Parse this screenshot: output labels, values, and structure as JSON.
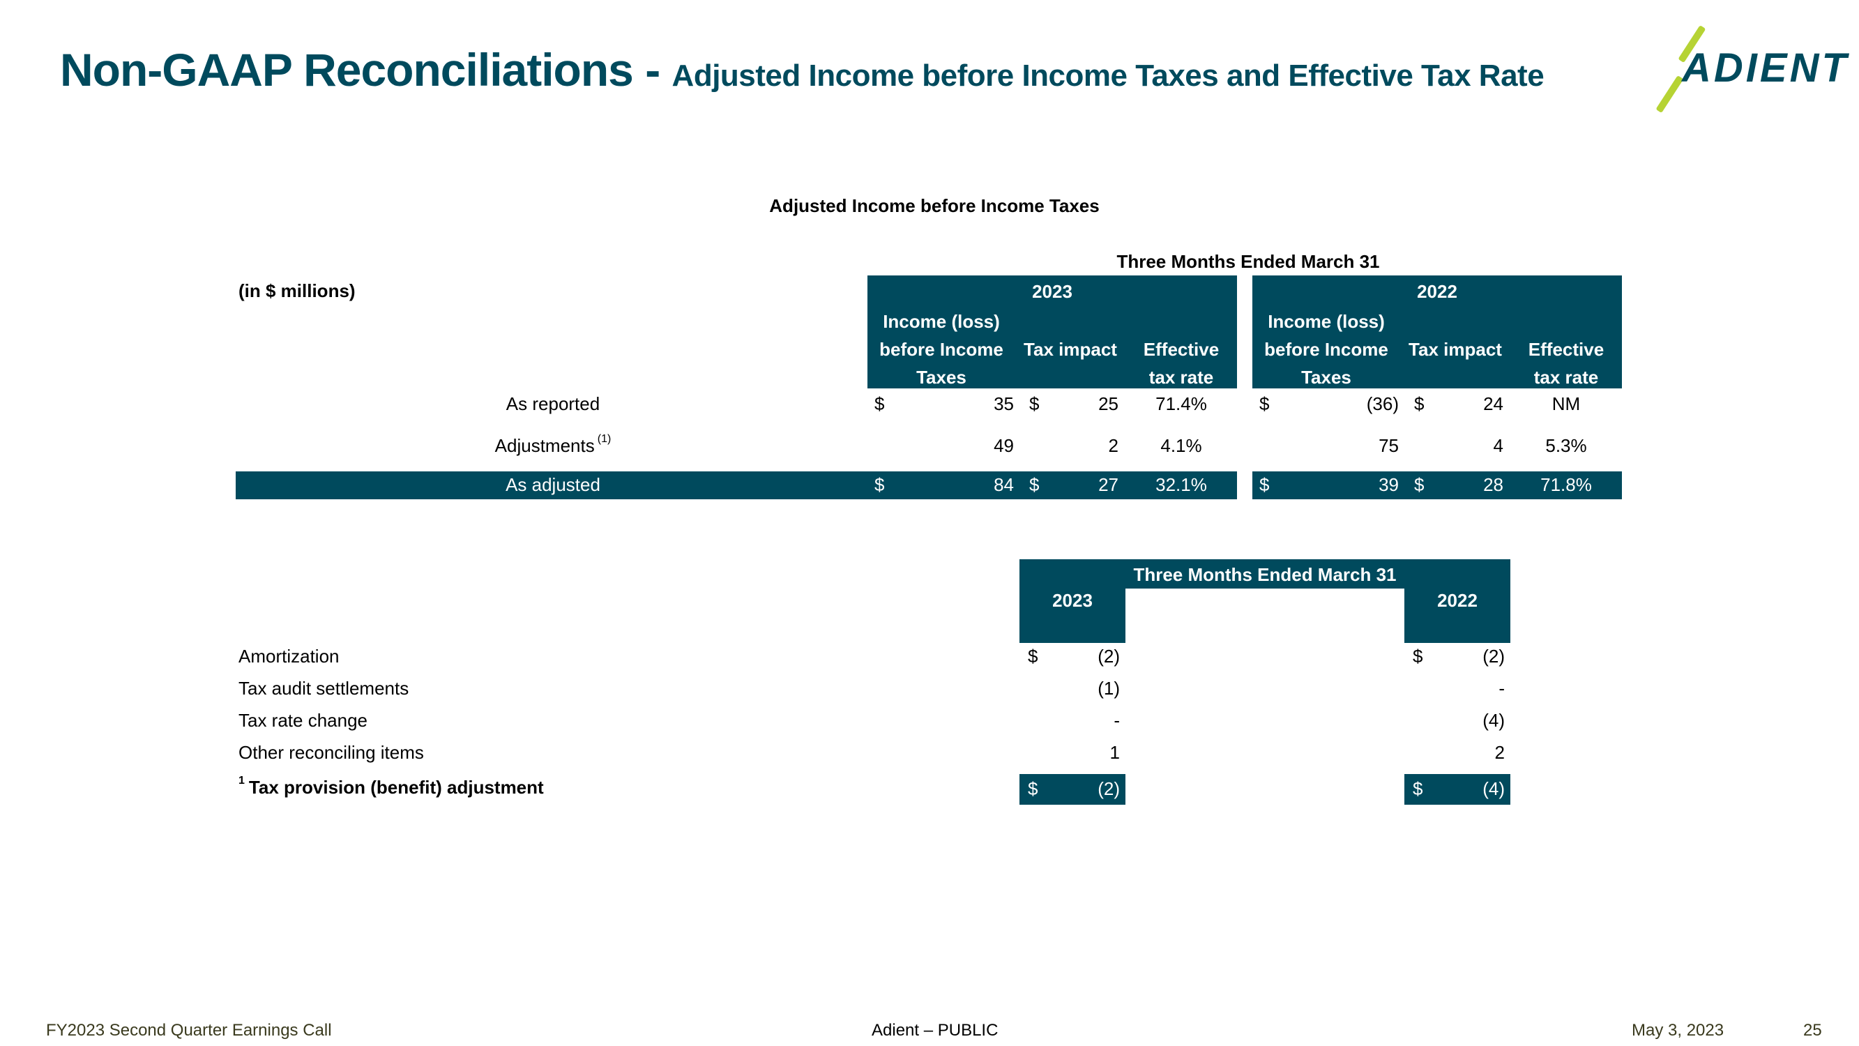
{
  "header": {
    "title_main": "Non-GAAP Reconciliations - ",
    "title_sub": "Adjusted Income before Income Taxes and Effective Tax Rate",
    "logo_text": "ADIENT",
    "colors": {
      "brand_teal": "#004a5d",
      "brand_lime": "#b6d334"
    }
  },
  "table1": {
    "title": "Adjusted Income before Income Taxes",
    "period_label": "Three Months Ended March 31",
    "units_label": "(in $ millions)",
    "years": [
      "2023",
      "2022"
    ],
    "columns": {
      "income": [
        "Income (loss)",
        "before Income",
        "Taxes"
      ],
      "tax_impact": "Tax impact",
      "etr": [
        "Effective",
        "tax rate"
      ]
    },
    "rows": [
      {
        "label": "As reported",
        "footnote": "",
        "y2023": {
          "income_cur": "$",
          "income": "35",
          "tax_cur": "$",
          "tax": "25",
          "etr": "71.4%"
        },
        "y2022": {
          "income_cur": "$",
          "income": "(36)",
          "tax_cur": "$",
          "tax": "24",
          "etr": "NM"
        }
      },
      {
        "label": "Adjustments",
        "footnote": "(1)",
        "y2023": {
          "income_cur": "",
          "income": "49",
          "tax_cur": "",
          "tax": "2",
          "etr": "4.1%"
        },
        "y2022": {
          "income_cur": "",
          "income": "75",
          "tax_cur": "",
          "tax": "4",
          "etr": "5.3%"
        }
      },
      {
        "label": "As adjusted",
        "footnote": "",
        "y2023": {
          "income_cur": "$",
          "income": "84",
          "tax_cur": "$",
          "tax": "27",
          "etr": "32.1%"
        },
        "y2022": {
          "income_cur": "$",
          "income": "39",
          "tax_cur": "$",
          "tax": "28",
          "etr": "71.8%"
        }
      }
    ]
  },
  "table2": {
    "period_label": "Three Months Ended March 31",
    "years": [
      "2023",
      "2022"
    ],
    "rows": [
      {
        "label": "Amortization",
        "y2023_cur": "$",
        "y2023": "(2)",
        "y2022_cur": "$",
        "y2022": "(2)"
      },
      {
        "label": "Tax audit settlements",
        "y2023_cur": "",
        "y2023": "(1)",
        "y2022_cur": "",
        "y2022": "-"
      },
      {
        "label": "Tax rate change",
        "y2023_cur": "",
        "y2023": "-",
        "y2022_cur": "",
        "y2022": "(4)"
      },
      {
        "label": "Other reconciling items",
        "y2023_cur": "",
        "y2023": "1",
        "y2022_cur": "",
        "y2022": "2"
      }
    ],
    "total": {
      "footnote": "1",
      "label": "Tax provision (benefit) adjustment",
      "y2023_cur": "$",
      "y2023": "(2)",
      "y2022_cur": "$",
      "y2022": "(4)"
    }
  },
  "footer": {
    "left": "FY2023 Second Quarter Earnings Call",
    "center": "Adient – PUBLIC",
    "date": "May 3, 2023",
    "page": "25"
  }
}
